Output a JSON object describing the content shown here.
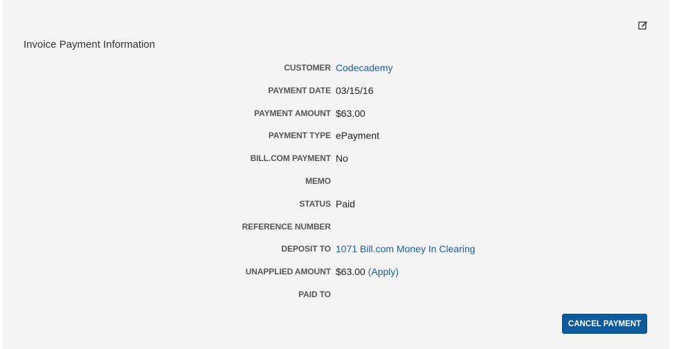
{
  "header": {
    "title": "Invoice Payment Information",
    "edit_icon": "edit-square-icon"
  },
  "fields": [
    {
      "label": "CUSTOMER",
      "value": "Codecademy",
      "is_link": true
    },
    {
      "label": "PAYMENT DATE",
      "value": "03/15/16"
    },
    {
      "label": "PAYMENT AMOUNT",
      "value": "$63.00"
    },
    {
      "label": "PAYMENT TYPE",
      "value": "ePayment"
    },
    {
      "label": "BILL.COM PAYMENT",
      "value": "No"
    },
    {
      "label": "MEMO",
      "value": ""
    },
    {
      "label": "STATUS",
      "value": "Paid"
    },
    {
      "label": "REFERENCE NUMBER",
      "value": ""
    },
    {
      "label": "DEPOSIT TO",
      "value": "1071 Bill.com Money In Clearing",
      "is_link": true
    },
    {
      "label": "UNAPPLIED AMOUNT",
      "value": "$63.00",
      "action_link": "(Apply)"
    },
    {
      "label": "PAID TO",
      "value": ""
    }
  ],
  "actions": {
    "cancel_label": "CANCEL PAYMENT"
  },
  "colors": {
    "panel_bg": "#f4f4f4",
    "link": "#1f5d99",
    "button_bg": "#0e5a9a"
  }
}
